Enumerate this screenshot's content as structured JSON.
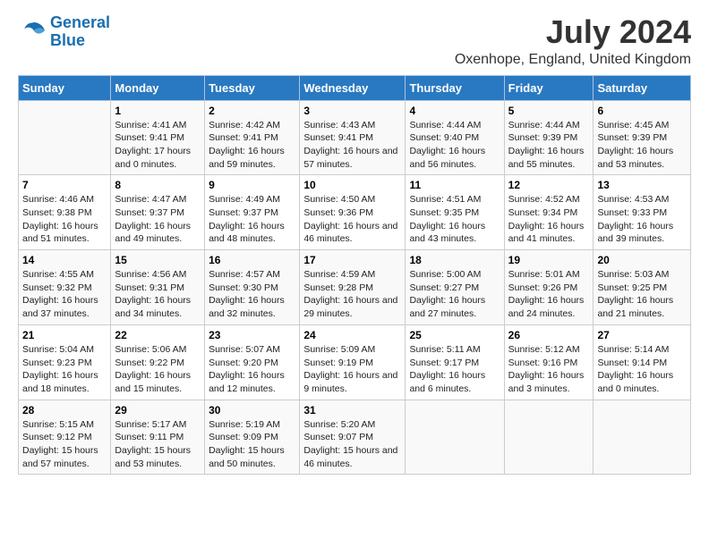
{
  "logo": {
    "line1": "General",
    "line2": "Blue"
  },
  "title": "July 2024",
  "subtitle": "Oxenhope, England, United Kingdom",
  "days_header": [
    "Sunday",
    "Monday",
    "Tuesday",
    "Wednesday",
    "Thursday",
    "Friday",
    "Saturday"
  ],
  "weeks": [
    [
      {
        "day": "",
        "sunrise": "",
        "sunset": "",
        "daylight": ""
      },
      {
        "day": "1",
        "sunrise": "Sunrise: 4:41 AM",
        "sunset": "Sunset: 9:41 PM",
        "daylight": "Daylight: 17 hours and 0 minutes."
      },
      {
        "day": "2",
        "sunrise": "Sunrise: 4:42 AM",
        "sunset": "Sunset: 9:41 PM",
        "daylight": "Daylight: 16 hours and 59 minutes."
      },
      {
        "day": "3",
        "sunrise": "Sunrise: 4:43 AM",
        "sunset": "Sunset: 9:41 PM",
        "daylight": "Daylight: 16 hours and 57 minutes."
      },
      {
        "day": "4",
        "sunrise": "Sunrise: 4:44 AM",
        "sunset": "Sunset: 9:40 PM",
        "daylight": "Daylight: 16 hours and 56 minutes."
      },
      {
        "day": "5",
        "sunrise": "Sunrise: 4:44 AM",
        "sunset": "Sunset: 9:39 PM",
        "daylight": "Daylight: 16 hours and 55 minutes."
      },
      {
        "day": "6",
        "sunrise": "Sunrise: 4:45 AM",
        "sunset": "Sunset: 9:39 PM",
        "daylight": "Daylight: 16 hours and 53 minutes."
      }
    ],
    [
      {
        "day": "7",
        "sunrise": "Sunrise: 4:46 AM",
        "sunset": "Sunset: 9:38 PM",
        "daylight": "Daylight: 16 hours and 51 minutes."
      },
      {
        "day": "8",
        "sunrise": "Sunrise: 4:47 AM",
        "sunset": "Sunset: 9:37 PM",
        "daylight": "Daylight: 16 hours and 49 minutes."
      },
      {
        "day": "9",
        "sunrise": "Sunrise: 4:49 AM",
        "sunset": "Sunset: 9:37 PM",
        "daylight": "Daylight: 16 hours and 48 minutes."
      },
      {
        "day": "10",
        "sunrise": "Sunrise: 4:50 AM",
        "sunset": "Sunset: 9:36 PM",
        "daylight": "Daylight: 16 hours and 46 minutes."
      },
      {
        "day": "11",
        "sunrise": "Sunrise: 4:51 AM",
        "sunset": "Sunset: 9:35 PM",
        "daylight": "Daylight: 16 hours and 43 minutes."
      },
      {
        "day": "12",
        "sunrise": "Sunrise: 4:52 AM",
        "sunset": "Sunset: 9:34 PM",
        "daylight": "Daylight: 16 hours and 41 minutes."
      },
      {
        "day": "13",
        "sunrise": "Sunrise: 4:53 AM",
        "sunset": "Sunset: 9:33 PM",
        "daylight": "Daylight: 16 hours and 39 minutes."
      }
    ],
    [
      {
        "day": "14",
        "sunrise": "Sunrise: 4:55 AM",
        "sunset": "Sunset: 9:32 PM",
        "daylight": "Daylight: 16 hours and 37 minutes."
      },
      {
        "day": "15",
        "sunrise": "Sunrise: 4:56 AM",
        "sunset": "Sunset: 9:31 PM",
        "daylight": "Daylight: 16 hours and 34 minutes."
      },
      {
        "day": "16",
        "sunrise": "Sunrise: 4:57 AM",
        "sunset": "Sunset: 9:30 PM",
        "daylight": "Daylight: 16 hours and 32 minutes."
      },
      {
        "day": "17",
        "sunrise": "Sunrise: 4:59 AM",
        "sunset": "Sunset: 9:28 PM",
        "daylight": "Daylight: 16 hours and 29 minutes."
      },
      {
        "day": "18",
        "sunrise": "Sunrise: 5:00 AM",
        "sunset": "Sunset: 9:27 PM",
        "daylight": "Daylight: 16 hours and 27 minutes."
      },
      {
        "day": "19",
        "sunrise": "Sunrise: 5:01 AM",
        "sunset": "Sunset: 9:26 PM",
        "daylight": "Daylight: 16 hours and 24 minutes."
      },
      {
        "day": "20",
        "sunrise": "Sunrise: 5:03 AM",
        "sunset": "Sunset: 9:25 PM",
        "daylight": "Daylight: 16 hours and 21 minutes."
      }
    ],
    [
      {
        "day": "21",
        "sunrise": "Sunrise: 5:04 AM",
        "sunset": "Sunset: 9:23 PM",
        "daylight": "Daylight: 16 hours and 18 minutes."
      },
      {
        "day": "22",
        "sunrise": "Sunrise: 5:06 AM",
        "sunset": "Sunset: 9:22 PM",
        "daylight": "Daylight: 16 hours and 15 minutes."
      },
      {
        "day": "23",
        "sunrise": "Sunrise: 5:07 AM",
        "sunset": "Sunset: 9:20 PM",
        "daylight": "Daylight: 16 hours and 12 minutes."
      },
      {
        "day": "24",
        "sunrise": "Sunrise: 5:09 AM",
        "sunset": "Sunset: 9:19 PM",
        "daylight": "Daylight: 16 hours and 9 minutes."
      },
      {
        "day": "25",
        "sunrise": "Sunrise: 5:11 AM",
        "sunset": "Sunset: 9:17 PM",
        "daylight": "Daylight: 16 hours and 6 minutes."
      },
      {
        "day": "26",
        "sunrise": "Sunrise: 5:12 AM",
        "sunset": "Sunset: 9:16 PM",
        "daylight": "Daylight: 16 hours and 3 minutes."
      },
      {
        "day": "27",
        "sunrise": "Sunrise: 5:14 AM",
        "sunset": "Sunset: 9:14 PM",
        "daylight": "Daylight: 16 hours and 0 minutes."
      }
    ],
    [
      {
        "day": "28",
        "sunrise": "Sunrise: 5:15 AM",
        "sunset": "Sunset: 9:12 PM",
        "daylight": "Daylight: 15 hours and 57 minutes."
      },
      {
        "day": "29",
        "sunrise": "Sunrise: 5:17 AM",
        "sunset": "Sunset: 9:11 PM",
        "daylight": "Daylight: 15 hours and 53 minutes."
      },
      {
        "day": "30",
        "sunrise": "Sunrise: 5:19 AM",
        "sunset": "Sunset: 9:09 PM",
        "daylight": "Daylight: 15 hours and 50 minutes."
      },
      {
        "day": "31",
        "sunrise": "Sunrise: 5:20 AM",
        "sunset": "Sunset: 9:07 PM",
        "daylight": "Daylight: 15 hours and 46 minutes."
      },
      {
        "day": "",
        "sunrise": "",
        "sunset": "",
        "daylight": ""
      },
      {
        "day": "",
        "sunrise": "",
        "sunset": "",
        "daylight": ""
      },
      {
        "day": "",
        "sunrise": "",
        "sunset": "",
        "daylight": ""
      }
    ]
  ]
}
